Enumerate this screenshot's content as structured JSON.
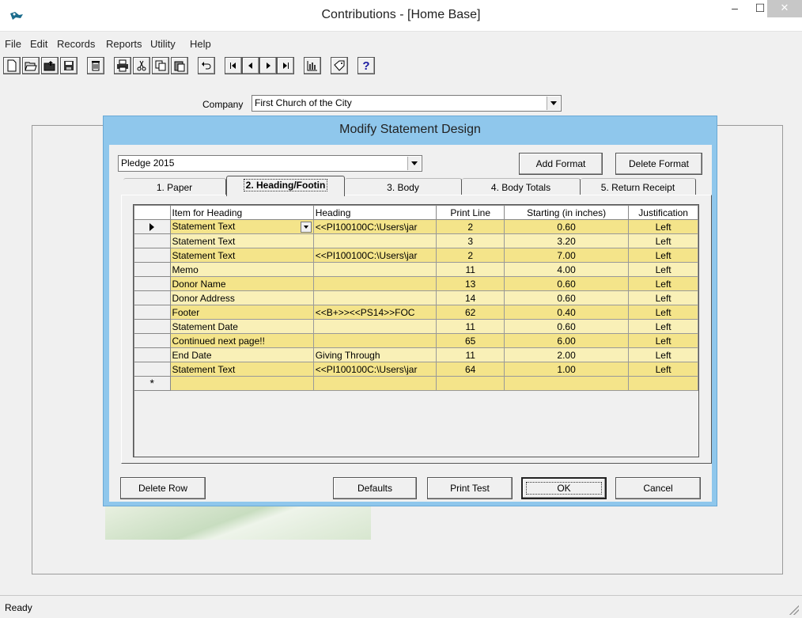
{
  "window": {
    "title": "Contributions - [Home Base]",
    "minimize": "–",
    "maximize": "☐",
    "close": "✕"
  },
  "menu": [
    "File",
    "Edit",
    "Records",
    "Reports",
    "Utility",
    "Help"
  ],
  "toolbar": {
    "icons": [
      "new-icon",
      "open-icon",
      "open-folder-icon",
      "save-icon",
      "delete-icon",
      "print-icon",
      "cut-icon",
      "copy-icon",
      "paste-icon",
      "undo-icon",
      "first-record-icon",
      "previous-record-icon",
      "next-record-icon",
      "last-record-icon",
      "chart-icon",
      "tag-icon",
      "help-icon"
    ],
    "help_label": "?"
  },
  "company": {
    "label": "Company",
    "value": "First Church of the City"
  },
  "dialog": {
    "title": "Modify Statement Design",
    "format_value": "Pledge 2015",
    "add_format": "Add Format",
    "delete_format": "Delete Format",
    "tabs": [
      "1. Paper",
      "2. Heading/Footin",
      "3. Body",
      "4. Body Totals",
      "5. Return Receipt"
    ],
    "active_tab": 1,
    "grid": {
      "columns": [
        "Item for Heading",
        "Heading",
        "Print Line",
        "Starting (in inches)",
        "Justification"
      ],
      "rows": [
        [
          "Statement Text",
          "<<PI100100C:\\Users\\jar",
          "2",
          "0.60",
          "Left"
        ],
        [
          "Statement Text",
          "",
          "3",
          "3.20",
          "Left"
        ],
        [
          "Statement Text",
          "<<PI100100C:\\Users\\jar",
          "2",
          "7.00",
          "Left"
        ],
        [
          "Memo",
          "",
          "11",
          "4.00",
          "Left"
        ],
        [
          "Donor Name",
          "",
          "13",
          "0.60",
          "Left"
        ],
        [
          "Donor Address",
          "",
          "14",
          "0.60",
          "Left"
        ],
        [
          "Footer",
          "<<B+>><<PS14>>FOC",
          "62",
          "0.40",
          "Left"
        ],
        [
          "Statement Date",
          "",
          "11",
          "0.60",
          "Left"
        ],
        [
          "Continued next page!!",
          "",
          "65",
          "6.00",
          "Left"
        ],
        [
          "End Date",
          "Giving Through",
          "11",
          "2.00",
          "Left"
        ],
        [
          "Statement Text",
          "<<PI100100C:\\Users\\jar",
          "64",
          "1.00",
          "Left"
        ]
      ],
      "new_row_marker": "*"
    },
    "buttons": {
      "delete_row": "Delete Row",
      "defaults": "Defaults",
      "print_test": "Print Test",
      "ok": "OK",
      "cancel": "Cancel"
    }
  },
  "status": {
    "text": "Ready"
  },
  "colors": {
    "dialog_frame": "#8fc7ec",
    "row_odd": "#f4e48a",
    "row_even": "#f9f0b7"
  }
}
